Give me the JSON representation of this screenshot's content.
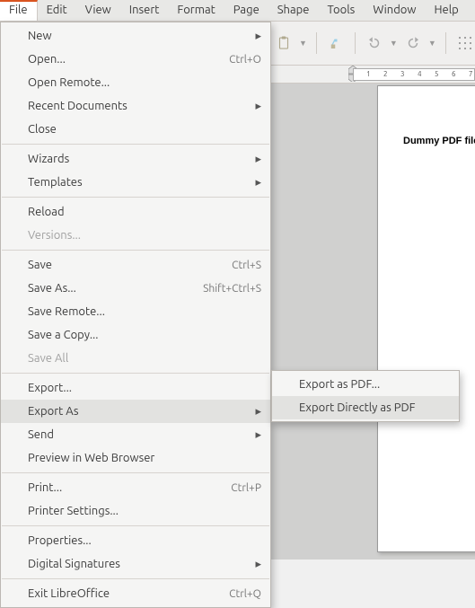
{
  "menubar": [
    "File",
    "Edit",
    "View",
    "Insert",
    "Format",
    "Page",
    "Shape",
    "Tools",
    "Window",
    "Help"
  ],
  "file_menu": {
    "new": "New",
    "open": "Open...",
    "open_accel": "Ctrl+O",
    "open_remote": "Open Remote...",
    "recent": "Recent Documents",
    "close": "Close",
    "wizards": "Wizards",
    "templates": "Templates",
    "reload": "Reload",
    "versions": "Versions...",
    "save": "Save",
    "save_accel": "Ctrl+S",
    "save_as": "Save As...",
    "save_as_accel": "Shift+Ctrl+S",
    "save_remote": "Save Remote...",
    "save_copy": "Save a Copy...",
    "save_all": "Save All",
    "export": "Export...",
    "export_as": "Export As",
    "send": "Send",
    "preview": "Preview in Web Browser",
    "print": "Print...",
    "print_accel": "Ctrl+P",
    "printer_settings": "Printer Settings...",
    "properties": "Properties...",
    "digital_sig": "Digital Signatures",
    "exit": "Exit LibreOffice",
    "exit_accel": "Ctrl+Q"
  },
  "export_submenu": {
    "as_pdf": "Export as PDF...",
    "direct_pdf": "Export Directly as PDF"
  },
  "document": {
    "text": "Dummy PDF file"
  },
  "ruler_nums": [
    "1",
    "2",
    "3",
    "4",
    "5",
    "6",
    "7"
  ]
}
